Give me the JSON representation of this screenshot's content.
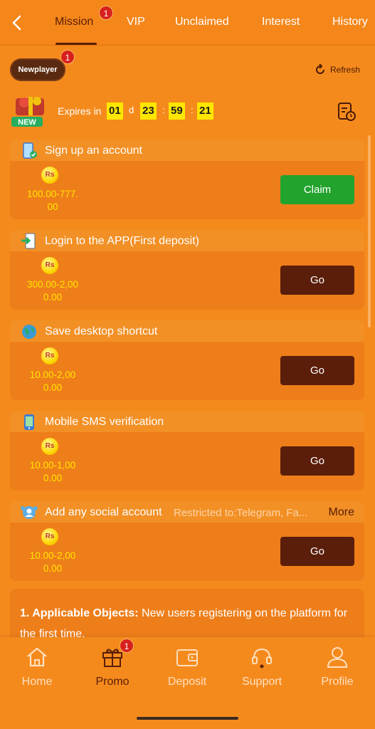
{
  "tabs": [
    {
      "label": "Mission",
      "active": true,
      "badge": "1"
    },
    {
      "label": "VIP"
    },
    {
      "label": "Unclaimed"
    },
    {
      "label": "Interest"
    },
    {
      "label": "History"
    }
  ],
  "newplayer": {
    "label": "Newplayer",
    "badge": "1"
  },
  "refresh_label": "Refresh",
  "promo": {
    "gift_tag": "NEW",
    "expires_label": "Expires in",
    "days": "01",
    "day_unit": "d",
    "hours": "23",
    "minutes": "59",
    "seconds": "21",
    "sep": ":"
  },
  "currency_icon": "Rs",
  "missions": [
    {
      "title": "Sign up an account",
      "amount_line1": "100.00-777.",
      "amount_line2": "00",
      "button": "Claim",
      "icon": "phone-check-icon"
    },
    {
      "title": "Login to the APP(First deposit)",
      "amount_line1": "300.00-2,00",
      "amount_line2": "0.00",
      "button": "Go",
      "icon": "login-app-icon"
    },
    {
      "title": "Save desktop shortcut",
      "amount_line1": "10.00-2,00",
      "amount_line2": "0.00",
      "button": "Go",
      "icon": "globe-icon"
    },
    {
      "title": "Mobile SMS verification",
      "amount_line1": "10.00-1,00",
      "amount_line2": "0.00",
      "button": "Go",
      "icon": "phone-icon"
    },
    {
      "title": "Add any social account",
      "restricted": "Restricted to:Telegram, Fa...",
      "more": "More",
      "amount_line1": "10.00-2,00",
      "amount_line2": "0.00",
      "button": "Go",
      "icon": "social-icon"
    }
  ],
  "description": {
    "heading": "1. Applicable Objects:",
    "text": " New users registering on the platform for the first time."
  },
  "bottom_nav": [
    {
      "label": "Home",
      "icon": "home-icon"
    },
    {
      "label": "Promo",
      "icon": "gift-icon",
      "active": true,
      "badge": "1"
    },
    {
      "label": "Deposit",
      "icon": "wallet-icon"
    },
    {
      "label": "Support",
      "icon": "headset-icon"
    },
    {
      "label": "Profile",
      "icon": "user-icon"
    }
  ],
  "colors": {
    "background": "#f58a1c",
    "accent_dark": "#5a1e0a",
    "claim": "#22a32e",
    "timer": "#ffe600",
    "badge": "#d8201c"
  }
}
